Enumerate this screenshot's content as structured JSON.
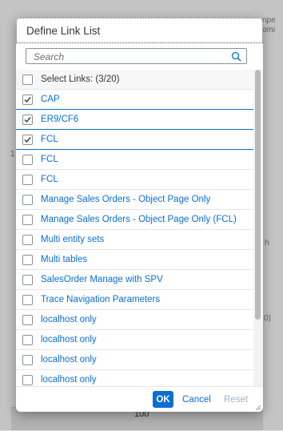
{
  "background": {
    "fragments": [
      "npe",
      "omi",
      "h",
      "0)",
      "1"
    ],
    "bottom_value": "100"
  },
  "dialog": {
    "title": "Define Link List",
    "search": {
      "placeholder": "Search"
    },
    "select_all": {
      "label": "Select Links: (3/20)",
      "checked": false
    },
    "links": [
      {
        "label": "CAP",
        "checked": true
      },
      {
        "label": "ER9/CF6",
        "checked": true
      },
      {
        "label": "FCL",
        "checked": true
      },
      {
        "label": "FCL",
        "checked": false
      },
      {
        "label": "FCL",
        "checked": false
      },
      {
        "label": "Manage Sales Orders - Object Page Only",
        "checked": false
      },
      {
        "label": "Manage Sales Orders - Object Page Only (FCL)",
        "checked": false
      },
      {
        "label": "Multi entity sets",
        "checked": false
      },
      {
        "label": "Multi tables",
        "checked": false
      },
      {
        "label": "SalesOrder Manage with SPV",
        "checked": false
      },
      {
        "label": "Trace Navigation Parameters",
        "checked": false
      },
      {
        "label": "localhost only",
        "checked": false
      },
      {
        "label": "localhost only",
        "checked": false
      },
      {
        "label": "localhost only",
        "checked": false
      },
      {
        "label": "localhost only",
        "checked": false
      }
    ],
    "footer": {
      "ok_label": "OK",
      "cancel_label": "Cancel",
      "reset_label": "Reset"
    }
  },
  "colors": {
    "accent": "#0a6ed1",
    "text": "#32363a"
  },
  "icons": {
    "search": "search-icon",
    "check": "checkmark-icon",
    "resize": "resize-handle-icon"
  }
}
